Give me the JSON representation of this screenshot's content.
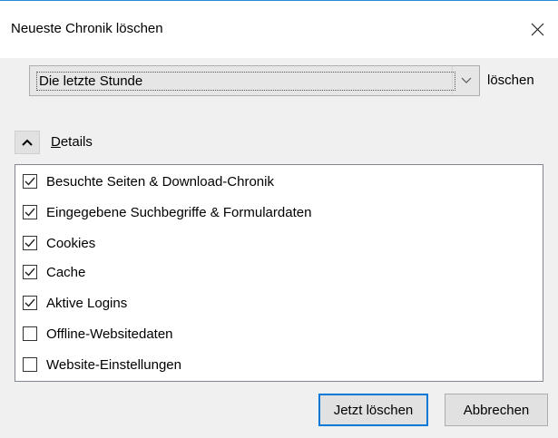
{
  "window": {
    "title": "Neueste Chronik löschen"
  },
  "range": {
    "selected": "Die letzte Stunde",
    "suffix": "löschen"
  },
  "details": {
    "label_first": "D",
    "label_rest": "etails",
    "expanded": true
  },
  "items": [
    {
      "label": "Besuchte Seiten & Download-Chronik",
      "checked": true
    },
    {
      "label": "Eingegebene Suchbegriffe & Formulardaten",
      "checked": true
    },
    {
      "label": "Cookies",
      "checked": true
    },
    {
      "label": "Cache",
      "checked": true
    },
    {
      "label": "Aktive Logins",
      "checked": true
    },
    {
      "label": "Offline-Websitedaten",
      "checked": false
    },
    {
      "label": "Website-Einstellungen",
      "checked": false
    }
  ],
  "buttons": {
    "confirm": "Jetzt löschen",
    "cancel": "Abbrechen"
  },
  "colors": {
    "accent": "#0078d7",
    "titlebar_border": "#2b8ad8"
  }
}
